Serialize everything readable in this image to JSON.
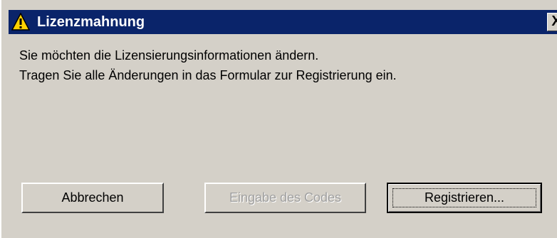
{
  "window": {
    "title": "Lizenzmahnung",
    "title_icon": "warning-icon",
    "close_label": "X"
  },
  "message": {
    "line1": "Sie möchten die Lizensierungsinformationen ändern.",
    "line2": "Tragen Sie alle Änderungen in das Formular zur Registrierung ein."
  },
  "buttons": {
    "cancel_label": "Abbrechen",
    "enter_code_label": "Eingabe des Codes",
    "enter_code_enabled": false,
    "register_label": "Registrieren..."
  },
  "colors": {
    "titlebar": "#0a246a",
    "dialog_background": "#d4d0c8",
    "warning_yellow": "#ffd200"
  }
}
